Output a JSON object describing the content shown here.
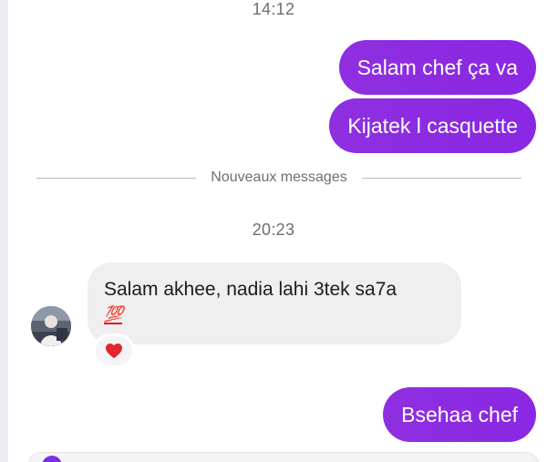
{
  "thread": {
    "timestamp_top": "14:12",
    "timestamp_middle": "20:23",
    "divider_label": "Nouveaux messages",
    "messages": [
      {
        "direction": "outgoing",
        "text": "Salam chef ça va"
      },
      {
        "direction": "outgoing",
        "text": "Kijatek l casquette"
      },
      {
        "direction": "incoming",
        "text": "Salam akhee, nadia lahi 3tek sa7a",
        "emoji": "💯"
      },
      {
        "direction": "outgoing",
        "text": "Bsehaa chef"
      }
    ],
    "reaction": {
      "emoji_icon": "heart-icon",
      "message_index": 2
    }
  },
  "colors": {
    "outgoing_bubble": "#8a2be2",
    "incoming_bubble": "#efefef",
    "reaction_heart": "#e0262f",
    "muted_text": "#6e6e73",
    "background": "#ffffff"
  }
}
